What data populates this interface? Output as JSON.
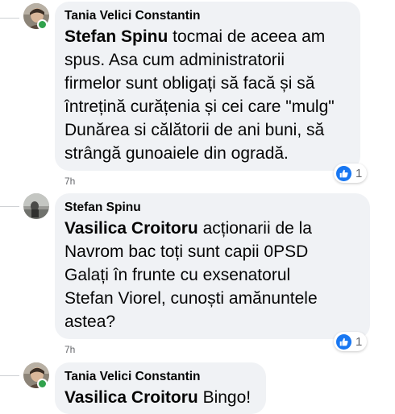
{
  "comments": [
    {
      "author": "Tania Velici Constantin",
      "mention": "Stefan Spinu",
      "body_lines": [
        " tocmai de aceea am",
        "spus. Asa cum administratorii",
        "firmelor sunt obligați să facă și să",
        "întrețină curățenia și cei care \"mulg\"",
        "Dunărea si călătorii de ani buni, să",
        "strângă gunoaiele din ogradă."
      ],
      "time": "7h",
      "reaction_icon": "like-icon",
      "reaction_count": "1",
      "online": true
    },
    {
      "author": "Stefan Spinu",
      "mention": "Vasilica Croitoru",
      "body_lines": [
        " acționarii de la",
        "Navrom bac toți sunt capii 0PSD",
        "Galați în frunte cu exsenatorul",
        "Stefan Viorel, cunoști amănuntele",
        "astea?"
      ],
      "time": "7h",
      "reaction_icon": "like-icon",
      "reaction_count": "1",
      "online": false
    },
    {
      "author": "Tania Velici Constantin",
      "mention": "Vasilica Croitoru",
      "body_lines": [
        " Bingo!"
      ],
      "online": true
    }
  ],
  "colors": {
    "bubble": "#f0f2f5",
    "like": "#1877f2",
    "online": "#31a24c",
    "muted": "#65676b"
  }
}
